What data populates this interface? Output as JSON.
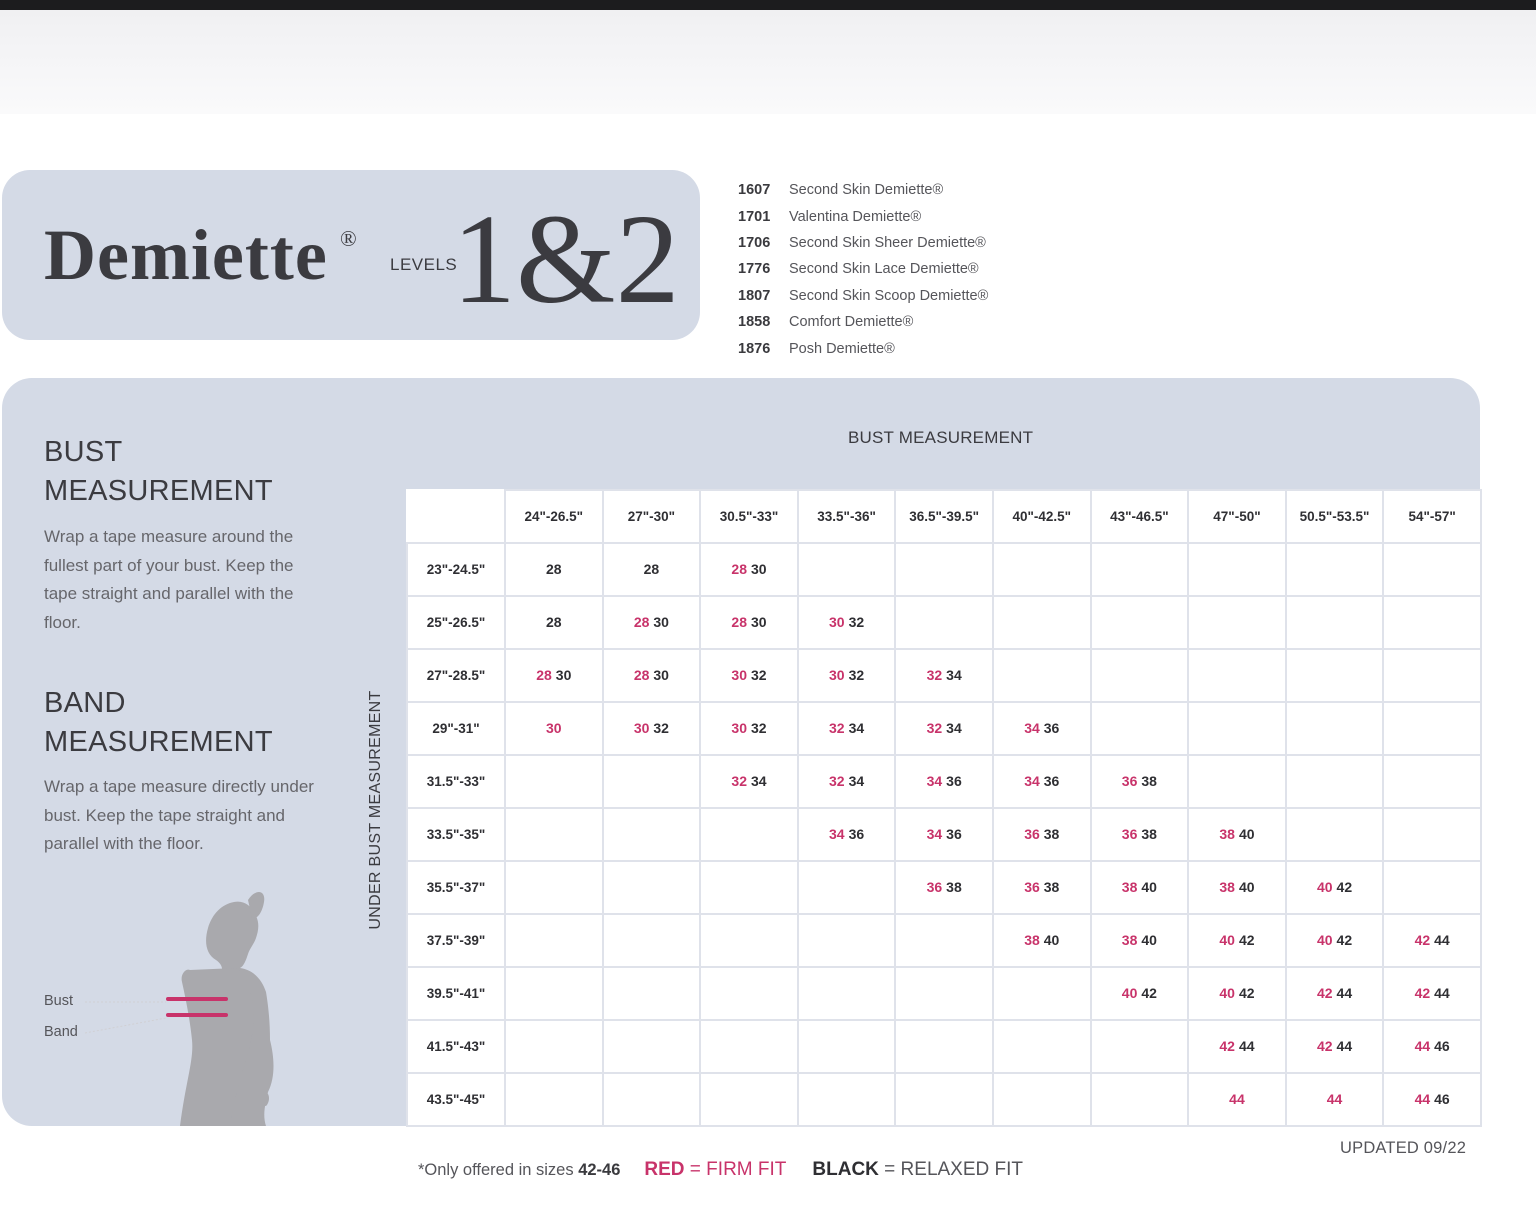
{
  "brand": {
    "name": "Demiette",
    "reg": "®",
    "levels_label": "LEVELS",
    "levels_num": "1&2"
  },
  "styles": [
    {
      "code": "1607",
      "name": "Second Skin Demiette®"
    },
    {
      "code": "1701",
      "name": "Valentina Demiette®"
    },
    {
      "code": "1706",
      "name": "Second Skin Sheer Demiette®"
    },
    {
      "code": "1776",
      "name": "Second Skin Lace Demiette®"
    },
    {
      "code": "1807",
      "name": "Second Skin Scoop Demiette®"
    },
    {
      "code": "1858",
      "name": "Comfort Demiette®"
    },
    {
      "code": "1876",
      "name": "Posh Demiette®"
    }
  ],
  "bust_section": {
    "title_line1": "BUST",
    "title_line2": "MEASUREMENT",
    "text": "Wrap a tape measure around the fullest part of your bust. Keep the tape straight and parallel with the floor."
  },
  "band_section": {
    "title_line1": "BAND",
    "title_line2": "MEASUREMENT",
    "text": "Wrap a tape measure directly under bust. Keep the tape straight and parallel with the floor."
  },
  "figure": {
    "bust_label": "Bust",
    "band_label": "Band"
  },
  "table": {
    "bust_heading": "BUST MEASUREMENT",
    "under_heading": "UNDER BUST MEASUREMENT",
    "columns": [
      "24\"-26.5\"",
      "27\"-30\"",
      "30.5\"-33\"",
      "33.5\"-36\"",
      "36.5\"-39.5\"",
      "40\"-42.5\"",
      "43\"-46.5\"",
      "47\"-50\"",
      "50.5\"-53.5\"",
      "54\"-57\""
    ],
    "rows": [
      {
        "label": "23\"-24.5\"",
        "cells": [
          [
            {
              "v": "28",
              "fit": "relaxed"
            }
          ],
          [
            {
              "v": "28",
              "fit": "relaxed"
            }
          ],
          [
            {
              "v": "28",
              "fit": "firm"
            },
            {
              "v": "30",
              "fit": "relaxed"
            }
          ],
          [],
          [],
          [],
          [],
          [],
          [],
          []
        ]
      },
      {
        "label": "25\"-26.5\"",
        "cells": [
          [
            {
              "v": "28",
              "fit": "relaxed"
            }
          ],
          [
            {
              "v": "28",
              "fit": "firm"
            },
            {
              "v": "30",
              "fit": "relaxed"
            }
          ],
          [
            {
              "v": "28",
              "fit": "firm"
            },
            {
              "v": "30",
              "fit": "relaxed"
            }
          ],
          [
            {
              "v": "30",
              "fit": "firm"
            },
            {
              "v": "32",
              "fit": "relaxed"
            }
          ],
          [],
          [],
          [],
          [],
          [],
          []
        ]
      },
      {
        "label": "27\"-28.5\"",
        "cells": [
          [
            {
              "v": "28",
              "fit": "firm"
            },
            {
              "v": "30",
              "fit": "relaxed"
            }
          ],
          [
            {
              "v": "28",
              "fit": "firm"
            },
            {
              "v": "30",
              "fit": "relaxed"
            }
          ],
          [
            {
              "v": "30",
              "fit": "firm"
            },
            {
              "v": "32",
              "fit": "relaxed"
            }
          ],
          [
            {
              "v": "30",
              "fit": "firm"
            },
            {
              "v": "32",
              "fit": "relaxed"
            }
          ],
          [
            {
              "v": "32",
              "fit": "firm"
            },
            {
              "v": "34",
              "fit": "relaxed"
            }
          ],
          [],
          [],
          [],
          [],
          []
        ]
      },
      {
        "label": "29\"-31\"",
        "cells": [
          [
            {
              "v": "30",
              "fit": "firm"
            }
          ],
          [
            {
              "v": "30",
              "fit": "firm"
            },
            {
              "v": "32",
              "fit": "relaxed"
            }
          ],
          [
            {
              "v": "30",
              "fit": "firm"
            },
            {
              "v": "32",
              "fit": "relaxed"
            }
          ],
          [
            {
              "v": "32",
              "fit": "firm"
            },
            {
              "v": "34",
              "fit": "relaxed"
            }
          ],
          [
            {
              "v": "32",
              "fit": "firm"
            },
            {
              "v": "34",
              "fit": "relaxed"
            }
          ],
          [
            {
              "v": "34",
              "fit": "firm"
            },
            {
              "v": "36",
              "fit": "relaxed"
            }
          ],
          [],
          [],
          [],
          []
        ]
      },
      {
        "label": "31.5\"-33\"",
        "cells": [
          [],
          [],
          [
            {
              "v": "32",
              "fit": "firm"
            },
            {
              "v": "34",
              "fit": "relaxed"
            }
          ],
          [
            {
              "v": "32",
              "fit": "firm"
            },
            {
              "v": "34",
              "fit": "relaxed"
            }
          ],
          [
            {
              "v": "34",
              "fit": "firm"
            },
            {
              "v": "36",
              "fit": "relaxed"
            }
          ],
          [
            {
              "v": "34",
              "fit": "firm"
            },
            {
              "v": "36",
              "fit": "relaxed"
            }
          ],
          [
            {
              "v": "36",
              "fit": "firm"
            },
            {
              "v": "38",
              "fit": "relaxed"
            }
          ],
          [],
          [],
          []
        ]
      },
      {
        "label": "33.5\"-35\"",
        "cells": [
          [],
          [],
          [],
          [
            {
              "v": "34",
              "fit": "firm"
            },
            {
              "v": "36",
              "fit": "relaxed"
            }
          ],
          [
            {
              "v": "34",
              "fit": "firm"
            },
            {
              "v": "36",
              "fit": "relaxed"
            }
          ],
          [
            {
              "v": "36",
              "fit": "firm"
            },
            {
              "v": "38",
              "fit": "relaxed"
            }
          ],
          [
            {
              "v": "36",
              "fit": "firm"
            },
            {
              "v": "38",
              "fit": "relaxed"
            }
          ],
          [
            {
              "v": "38",
              "fit": "firm"
            },
            {
              "v": "40",
              "fit": "relaxed"
            }
          ],
          [],
          []
        ]
      },
      {
        "label": "35.5\"-37\"",
        "cells": [
          [],
          [],
          [],
          [],
          [
            {
              "v": "36",
              "fit": "firm"
            },
            {
              "v": "38",
              "fit": "relaxed"
            }
          ],
          [
            {
              "v": "36",
              "fit": "firm"
            },
            {
              "v": "38",
              "fit": "relaxed"
            }
          ],
          [
            {
              "v": "38",
              "fit": "firm"
            },
            {
              "v": "40",
              "fit": "relaxed"
            }
          ],
          [
            {
              "v": "38",
              "fit": "firm"
            },
            {
              "v": "40",
              "fit": "relaxed"
            }
          ],
          [
            {
              "v": "40",
              "fit": "firm"
            },
            {
              "v": "42",
              "fit": "relaxed"
            }
          ],
          []
        ]
      },
      {
        "label": "37.5\"-39\"",
        "cells": [
          [],
          [],
          [],
          [],
          [],
          [
            {
              "v": "38",
              "fit": "firm"
            },
            {
              "v": "40",
              "fit": "relaxed"
            }
          ],
          [
            {
              "v": "38",
              "fit": "firm"
            },
            {
              "v": "40",
              "fit": "relaxed"
            }
          ],
          [
            {
              "v": "40",
              "fit": "firm"
            },
            {
              "v": "42",
              "fit": "relaxed"
            }
          ],
          [
            {
              "v": "40",
              "fit": "firm"
            },
            {
              "v": "42",
              "fit": "relaxed"
            }
          ],
          [
            {
              "v": "42",
              "fit": "firm"
            },
            {
              "v": "44",
              "fit": "relaxed"
            }
          ]
        ]
      },
      {
        "label": "39.5\"-41\"",
        "cells": [
          [],
          [],
          [],
          [],
          [],
          [],
          [
            {
              "v": "40",
              "fit": "firm"
            },
            {
              "v": "42",
              "fit": "relaxed"
            }
          ],
          [
            {
              "v": "40",
              "fit": "firm"
            },
            {
              "v": "42",
              "fit": "relaxed"
            }
          ],
          [
            {
              "v": "42",
              "fit": "firm"
            },
            {
              "v": "44",
              "fit": "relaxed"
            }
          ],
          [
            {
              "v": "42",
              "fit": "firm"
            },
            {
              "v": "44",
              "fit": "relaxed"
            }
          ]
        ]
      },
      {
        "label": "41.5\"-43\"",
        "cells": [
          [],
          [],
          [],
          [],
          [],
          [],
          [],
          [
            {
              "v": "42",
              "fit": "firm"
            },
            {
              "v": "44",
              "fit": "relaxed"
            }
          ],
          [
            {
              "v": "42",
              "fit": "firm"
            },
            {
              "v": "44",
              "fit": "relaxed"
            }
          ],
          [
            {
              "v": "44",
              "fit": "firm"
            },
            {
              "v": "46",
              "fit": "relaxed"
            }
          ]
        ]
      },
      {
        "label": "43.5\"-45\"",
        "cells": [
          [],
          [],
          [],
          [],
          [],
          [],
          [],
          [
            {
              "v": "44",
              "fit": "firm"
            }
          ],
          [
            {
              "v": "44",
              "fit": "firm"
            }
          ],
          [
            {
              "v": "44",
              "fit": "firm"
            },
            {
              "v": "46",
              "fit": "relaxed"
            }
          ]
        ]
      }
    ]
  },
  "footer": {
    "updated": "UPDATED 09/22",
    "note_prefix": "*Only offered in sizes ",
    "note_sizes": "42-46",
    "red_word": "RED",
    "red_meaning": " = FIRM FIT",
    "black_word": "BLACK",
    "black_meaning": " = RELAXED FIT"
  },
  "colors": {
    "firm_fit": "#c8336a",
    "relaxed_fit": "#2f2f33",
    "panel": "#d4dae6"
  }
}
